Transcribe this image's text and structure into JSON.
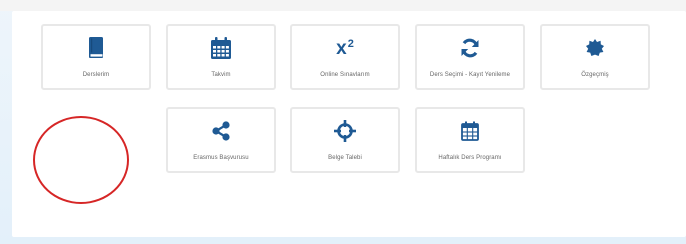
{
  "tiles": [
    {
      "label": "Derslerim",
      "icon": "book-icon"
    },
    {
      "label": "Takvim",
      "icon": "calendar-icon"
    },
    {
      "label": "Online Sınavlarım",
      "icon": "superscript-icon",
      "icon_text": "x",
      "icon_sup": "2"
    },
    {
      "label": "Ders Seçimi - Kayıt Yenileme",
      "icon": "refresh-icon"
    },
    {
      "label": "Özgeçmiş",
      "icon": "certificate-icon"
    },
    {
      "label": "Erasmus Başvurusu",
      "icon": "share-icon"
    },
    {
      "label": "Belge Talebi",
      "icon": "crosshairs-icon"
    },
    {
      "label": "Haftalık Ders Programı",
      "icon": "calendar-grid-icon"
    }
  ],
  "colors": {
    "icon": "#1f5a94",
    "label": "#666666",
    "tile_border": "#e8e8e8",
    "annotation_circle": "#d62626"
  }
}
